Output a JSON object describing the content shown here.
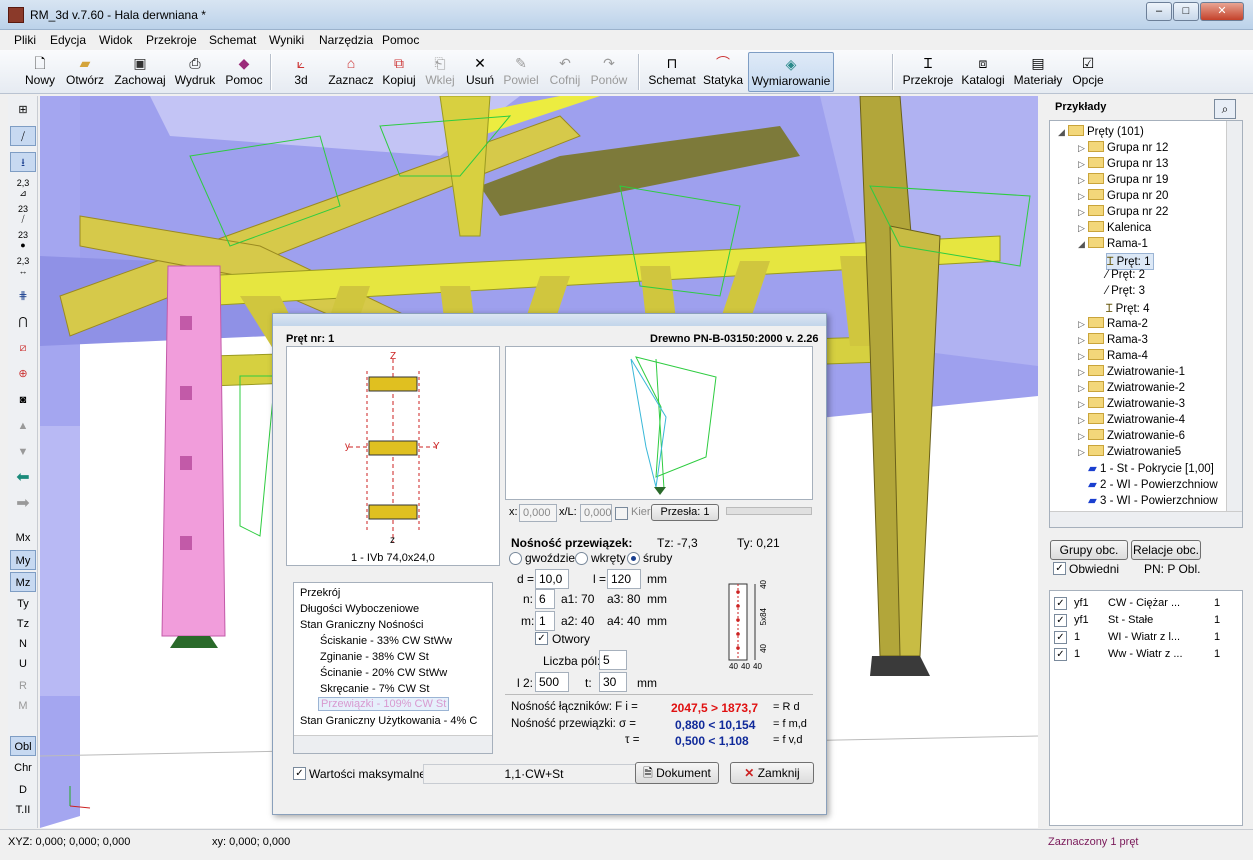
{
  "window": {
    "title": "RM_3d v.7.60 - Hala derwniana *",
    "min": "–",
    "max": "□",
    "close": "✕"
  },
  "menu": [
    "Pliki",
    "Edycja",
    "Widok",
    "Przekroje",
    "Schemat",
    "Wyniki",
    "Narzędzia",
    "Pomoc"
  ],
  "toolbar": {
    "nowy": "Nowy",
    "otworz": "Otwórz",
    "zachowaj": "Zachowaj",
    "wydruk": "Wydruk",
    "pomoc": "Pomoc",
    "d3": "3d",
    "zaznacz": "Zaznacz",
    "kopiuj": "Kopiuj",
    "wklej": "Wklej",
    "usun": "Usuń",
    "powiel": "Powiel",
    "cofnij": "Cofnij",
    "ponow": "Ponów",
    "schemat": "Schemat",
    "statyka": "Statyka",
    "wymiarowanie": "Wymiarowanie",
    "przekroje": "Przekroje",
    "katalogi": "Katalogi",
    "materialy": "Materiały",
    "opcje": "Opcje"
  },
  "left_toolbar": {
    "lbl1": "2,3",
    "lbl2": "23",
    "lbl3": "23",
    "lbl4": "2,3",
    "items": [
      "Mx",
      "My",
      "Mz",
      "Ty",
      "Tz",
      "N",
      "U",
      "R",
      "M",
      "Obl",
      "Chr",
      "D",
      "T.II"
    ]
  },
  "dialog": {
    "bar_label": "Pręt nr:  1",
    "norm": "Drewno PN-B-03150:2000 v. 2.26",
    "section_name": "1 - IVb 74,0x24,0",
    "axis_z": "z",
    "axis_Z": "Z",
    "axis_y": "y",
    "axis_Y": "Y",
    "x_label": "x:",
    "x_val": "0,000",
    "xl_label": "x/L:",
    "xl_val": "0,000",
    "kier": "Kier",
    "przesla": "Przesła: 1",
    "list": [
      "Przekrój",
      "Długości Wyboczeniowe",
      "Stan Graniczny Nośności",
      "Ściskanie - 33%   CW StWw",
      "Zginanie - 38%   CW St",
      "Ścinanie - 20%   CW StWw",
      "Skręcanie - 7%   CW St",
      "Przewiązki - 109%    CW St",
      "Stan Graniczny Użytkowania - 4%   C"
    ],
    "nosnosc_title": "Nośność przewiązek:",
    "tz": "Tz:  -7,3",
    "ty": "Ty:  0,21",
    "r_gwozdzie": "gwoździe",
    "r_wkrety": "wkręty",
    "r_sruby": "śruby",
    "d_label": "d =",
    "d_val": "10,0",
    "l_label": "l =",
    "l_val": "120",
    "mm1": "mm",
    "n_label": "n:",
    "n_val": "6",
    "a1_label": "a1: 70",
    "a3_label": "a3: 80",
    "mm2": "mm",
    "m_label": "m:",
    "m_val": "1",
    "a2_label": "a2: 40",
    "a4_label": "a4: 40",
    "mm3": "mm",
    "otwory": "Otwory",
    "liczba_pol": "Liczba pól:",
    "liczba_val": "5",
    "l2_label": "l 2:",
    "l2_val": "500",
    "t_label": "t:",
    "t_val": "30",
    "mm4": "mm",
    "nl_label": "Nośność łączników:  F i =",
    "nl_val": "2047,5 > 1873,7",
    "nl_r": "= R d",
    "np_label": "Nośność przewiązki:  σ =",
    "np_val": "0,880 < 10,154",
    "np_r": "= f m,d",
    "tau_label": "τ =",
    "tau_val": "0,500 < 1,108",
    "tau_r": "= f v,d",
    "wart_max": "Wartości maksymalne",
    "combo": "1,1·CW+St",
    "dokument": "Dokument",
    "zamknij": "Zamknij",
    "scheme_dims": {
      "d1": "40",
      "d2": "5x84",
      "d3": "40",
      "d4": "40",
      "d5": "40",
      "d6": "40"
    }
  },
  "right": {
    "title": "Przykłady",
    "tree": [
      "Pręty (101)",
      "Grupa nr 12",
      "Grupa nr 13",
      "Grupa nr 19",
      "Grupa nr 20",
      "Grupa nr 22",
      "Kalenica",
      "Rama-1",
      "Pręt: 1",
      "Pręt: 2",
      "Pręt: 3",
      "Pręt: 4",
      "Rama-2",
      "Rama-3",
      "Rama-4",
      "Zwiatrowanie-1",
      "Zwiatrowanie-2",
      "Zwiatrowanie-3",
      "Zwiatrowanie-4",
      "Zwiatrowanie-6",
      "Zwiatrowanie5",
      "1 - St - Pokrycie [1,00]",
      "2 - WI - Powierzchniow",
      "3 - WI - Powierzchniow"
    ],
    "grupy": "Grupy obc.",
    "relacje": "Relacje obc.",
    "obwiedni": "Obwiedni",
    "pn": "PN:  P Obl.",
    "loads": [
      [
        "yf1",
        "CW - Ciężar ...",
        "1"
      ],
      [
        "yf1",
        "St - Stałe",
        "1"
      ],
      [
        "1",
        "WI - Wiatr z l...",
        "1"
      ],
      [
        "1",
        "Ww - Wiatr z ...",
        "1"
      ]
    ]
  },
  "status": {
    "xyz": "XYZ: 0,000; 0,000; 0,000",
    "xy": "xy: 0,000; 0,000",
    "sel": "Zaznaczony 1 pręt"
  }
}
